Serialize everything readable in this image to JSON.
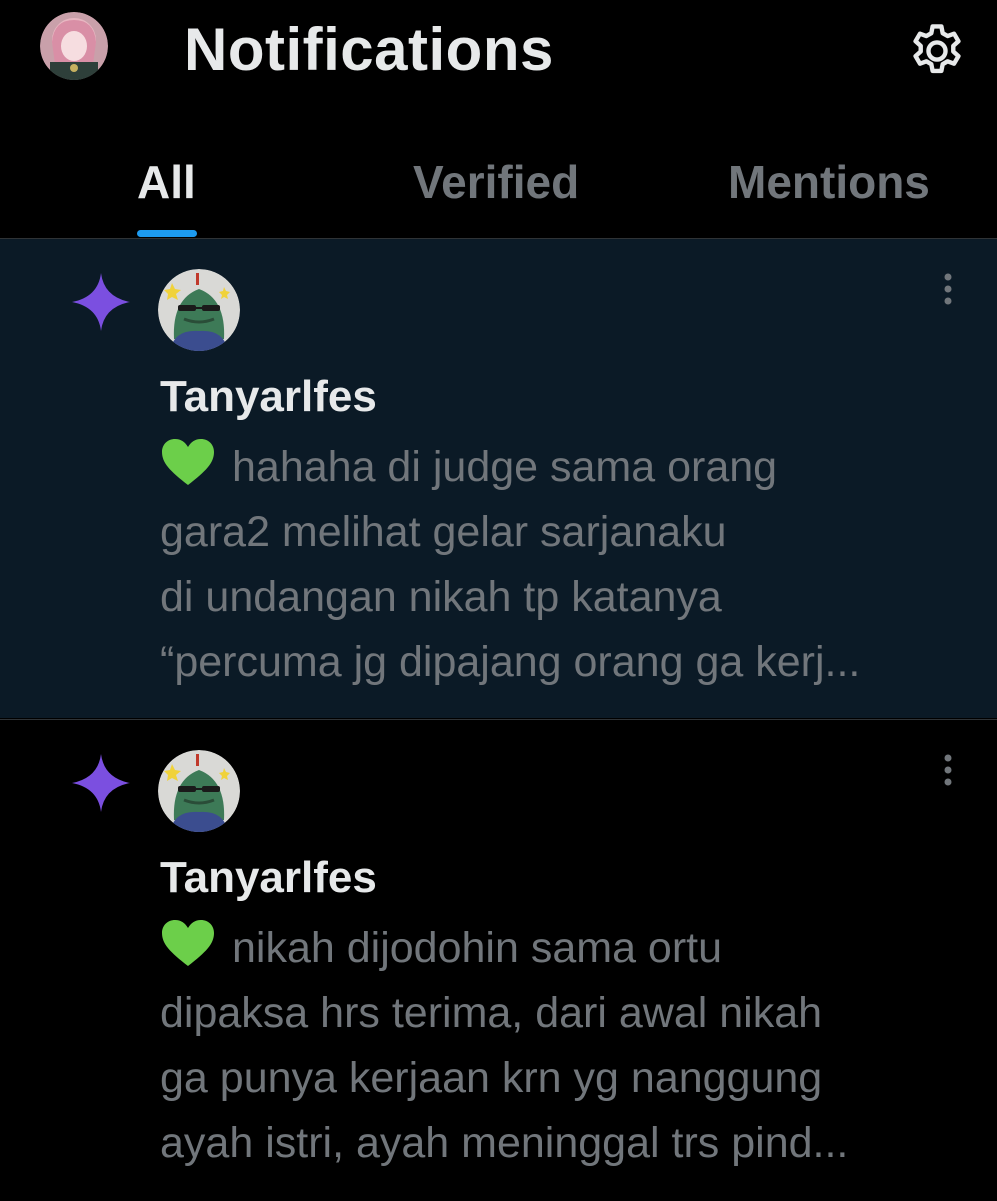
{
  "header": {
    "title": "Notifications",
    "profile_avatar_icon": "user-avatar-icon",
    "settings_icon": "gear-icon"
  },
  "tabs": [
    {
      "label": "All",
      "active": true
    },
    {
      "label": "Verified",
      "active": false
    },
    {
      "label": "Mentions",
      "active": false
    }
  ],
  "colors": {
    "background": "#000000",
    "highlight_bg": "#0b1a26",
    "accent": "#1d9bf0",
    "sparkle": "#7b4fe0",
    "heart": "#6ccf4a",
    "text_primary": "#e7e9ea",
    "text_secondary": "#71767b",
    "divider": "#2f3336"
  },
  "notifications": [
    {
      "unread": true,
      "type_icon": "sparkle-icon",
      "sender": "Tanyarlfes",
      "lines": [
        "hahaha di judge sama orang",
        "gara2 melihat gelar sarjanaku",
        "di undangan nikah tp katanya",
        "“percuma jg dipajang orang ga kerj..."
      ]
    },
    {
      "unread": false,
      "type_icon": "sparkle-icon",
      "sender": "Tanyarlfes",
      "lines": [
        "nikah dijodohin sama ortu",
        "dipaksa hrs terima, dari awal nikah",
        "ga punya kerjaan krn yg nanggung",
        "ayah istri, ayah meninggal trs pind..."
      ]
    }
  ]
}
